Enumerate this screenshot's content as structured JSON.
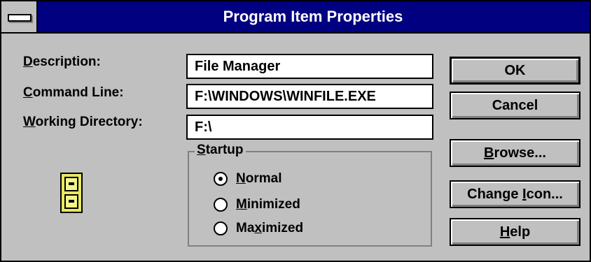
{
  "window": {
    "title": "Program Item Properties"
  },
  "form": {
    "description": {
      "label_mn": "D",
      "label_rest": "escription:",
      "value": "File Manager"
    },
    "command_line": {
      "label_mn": "C",
      "label_rest": "ommand Line:",
      "value": "F:\\WINDOWS\\WINFILE.EXE"
    },
    "working_directory": {
      "label_mn": "W",
      "label_rest": "orking Directory:",
      "value": "F:\\"
    }
  },
  "startup": {
    "legend_mn": "S",
    "legend_rest": "tartup",
    "options": [
      {
        "pre": "",
        "mn": "N",
        "post": "ormal",
        "selected": true
      },
      {
        "pre": "",
        "mn": "M",
        "post": "inimized",
        "selected": false
      },
      {
        "pre": "Ma",
        "mn": "x",
        "post": "imized",
        "selected": false
      }
    ]
  },
  "buttons": {
    "ok": {
      "pre": "",
      "mn": "",
      "post": "OK"
    },
    "cancel": {
      "pre": "",
      "mn": "",
      "post": "Cancel"
    },
    "browse": {
      "pre": "",
      "mn": "B",
      "post": "rowse..."
    },
    "change_icon": {
      "pre": "Change ",
      "mn": "I",
      "post": "con..."
    },
    "help": {
      "pre": "",
      "mn": "H",
      "post": "elp"
    }
  },
  "icon": {
    "name": "file-cabinet-icon",
    "color": "#e8e860"
  },
  "colors": {
    "titlebar": "#000080",
    "face": "#c0c0c0",
    "field": "#ffffff"
  }
}
